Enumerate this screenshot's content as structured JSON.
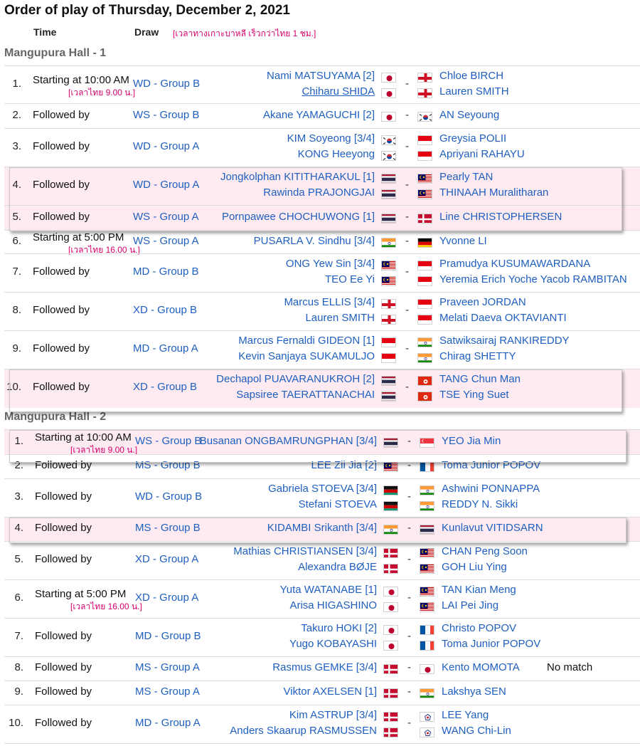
{
  "page": {
    "title": "Order of play of Thursday, December 2, 2021",
    "col_time": "Time",
    "col_draw": "Draw",
    "thai_note": "[เวลาทางเกาะบาหลี เร็วกว่าไทย 1 ชม.]"
  },
  "halls": [
    {
      "name": "Mangupura Hall - 1",
      "matches": [
        {
          "num": "1.",
          "time": "Starting at 10:00 AM",
          "note": "[เวลาไทย 9.00 น.]",
          "draw": "WD - Group B",
          "left": [
            {
              "name": "Nami MATSUYAMA [2]",
              "flag": "jpn"
            },
            {
              "name": "Chiharu SHIDA",
              "flag": "jpn",
              "underline": true
            }
          ],
          "right": [
            {
              "name": "Chloe BIRCH",
              "flag": "eng"
            },
            {
              "name": "Lauren SMITH",
              "flag": "eng"
            }
          ]
        },
        {
          "num": "2.",
          "time": "Followed by",
          "draw": "WS - Group B",
          "left": [
            {
              "name": "Akane YAMAGUCHI [2]",
              "flag": "jpn"
            }
          ],
          "right": [
            {
              "name": "AN Seyoung",
              "flag": "kor"
            }
          ]
        },
        {
          "num": "3.",
          "time": "Followed by",
          "draw": "WD - Group A",
          "left": [
            {
              "name": "KIM Soyeong [3/4]",
              "flag": "kor"
            },
            {
              "name": "KONG Heeyong",
              "flag": "kor"
            }
          ],
          "right": [
            {
              "name": "Greysia POLII",
              "flag": "ina"
            },
            {
              "name": "Apriyani RAHAYU",
              "flag": "ina"
            }
          ]
        },
        {
          "num": "4.",
          "time": "Followed by",
          "draw": "WD - Group A",
          "highlight": true,
          "left": [
            {
              "name": "Jongkolphan KITITHARAKUL [1]",
              "flag": "tha"
            },
            {
              "name": "Rawinda PRAJONGJAI",
              "flag": "tha"
            }
          ],
          "right": [
            {
              "name": "Pearly TAN",
              "flag": "mas"
            },
            {
              "name": "THINAAH Muralitharan",
              "flag": "mas"
            }
          ]
        },
        {
          "num": "5.",
          "time": "Followed by",
          "draw": "WS - Group A",
          "highlight": true,
          "left": [
            {
              "name": "Pornpawee CHOCHUWONG [1]",
              "flag": "tha"
            }
          ],
          "right": [
            {
              "name": "Line CHRISTOPHERSEN",
              "flag": "den"
            }
          ]
        },
        {
          "num": "6.",
          "time": "Starting at 5:00 PM",
          "note": "[เวลาไทย 16.00 น.]",
          "draw": "WS - Group A",
          "left": [
            {
              "name": "PUSARLA V. Sindhu [3/4]",
              "flag": "ind"
            }
          ],
          "right": [
            {
              "name": "Yvonne LI",
              "flag": "ger"
            }
          ]
        },
        {
          "num": "7.",
          "time": "Followed by",
          "draw": "MD - Group B",
          "left": [
            {
              "name": "ONG Yew Sin [3/4]",
              "flag": "mas"
            },
            {
              "name": "TEO Ee Yi",
              "flag": "mas"
            }
          ],
          "right": [
            {
              "name": "Pramudya KUSUMAWARDANA",
              "flag": "ina"
            },
            {
              "name": "Yeremia Erich Yoche Yacob RAMBITAN",
              "flag": "ina"
            }
          ]
        },
        {
          "num": "8.",
          "time": "Followed by",
          "draw": "XD - Group B",
          "left": [
            {
              "name": "Marcus ELLIS [3/4]",
              "flag": "eng"
            },
            {
              "name": "Lauren SMITH",
              "flag": "eng"
            }
          ],
          "right": [
            {
              "name": "Praveen JORDAN",
              "flag": "ina"
            },
            {
              "name": "Melati Daeva OKTAVIANTI",
              "flag": "ina"
            }
          ]
        },
        {
          "num": "9.",
          "time": "Followed by",
          "draw": "MD - Group A",
          "left": [
            {
              "name": "Marcus Fernaldi GIDEON [1]",
              "flag": "ina"
            },
            {
              "name": "Kevin Sanjaya SUKAMULJO",
              "flag": "ina"
            }
          ],
          "right": [
            {
              "name": "Satwiksairaj RANKIREDDY",
              "flag": "ind"
            },
            {
              "name": "Chirag SHETTY",
              "flag": "ind"
            }
          ]
        },
        {
          "num": "10.",
          "time": "Followed by",
          "draw": "XD - Group B",
          "highlight": true,
          "left": [
            {
              "name": "Dechapol PUAVARANUKROH [2]",
              "flag": "tha"
            },
            {
              "name": "Sapsiree TAERATTANACHAI",
              "flag": "tha"
            }
          ],
          "right": [
            {
              "name": "TANG Chun Man",
              "flag": "hkg"
            },
            {
              "name": "TSE Ying Suet",
              "flag": "hkg"
            }
          ]
        }
      ]
    },
    {
      "name": "Mangupura Hall - 2",
      "matches": [
        {
          "num": "1.",
          "time": "Starting at 10:00 AM",
          "note": "[เวลาไทย 9.00 น.]",
          "draw": "WS - Group B",
          "highlight": true,
          "left": [
            {
              "name": "Busanan ONGBAMRUNGPHAN [3/4]",
              "flag": "tha"
            }
          ],
          "right": [
            {
              "name": "YEO Jia Min",
              "flag": "sgp"
            }
          ]
        },
        {
          "num": "2.",
          "time": "Followed by",
          "draw": "MS - Group B",
          "left": [
            {
              "name": "LEE Zii Jia [2]",
              "flag": "mas"
            }
          ],
          "right": [
            {
              "name": "Toma Junior POPOV",
              "flag": "fra"
            }
          ]
        },
        {
          "num": "3.",
          "time": "Followed by",
          "draw": "WD - Group B",
          "left": [
            {
              "name": "Gabriela STOEVA [3/4]",
              "flag": "bul"
            },
            {
              "name": "Stefani STOEVA",
              "flag": "bul"
            }
          ],
          "right": [
            {
              "name": "Ashwini PONNAPPA",
              "flag": "ind"
            },
            {
              "name": "REDDY N. Sikki",
              "flag": "ind"
            }
          ]
        },
        {
          "num": "4.",
          "time": "Followed by",
          "draw": "MS - Group B",
          "highlight": true,
          "left": [
            {
              "name": "KIDAMBI Srikanth [3/4]",
              "flag": "ind"
            }
          ],
          "right": [
            {
              "name": "Kunlavut VITIDSARN",
              "flag": "tha"
            }
          ]
        },
        {
          "num": "5.",
          "time": "Followed by",
          "draw": "XD - Group A",
          "left": [
            {
              "name": "Mathias CHRISTIANSEN [3/4]",
              "flag": "den"
            },
            {
              "name": "Alexandra BØJE",
              "flag": "den"
            }
          ],
          "right": [
            {
              "name": "CHAN Peng Soon",
              "flag": "mas"
            },
            {
              "name": "GOH Liu Ying",
              "flag": "mas"
            }
          ]
        },
        {
          "num": "6.",
          "time": "Starting at 5:00 PM",
          "note": "[เวลาไทย 16.00 น.]",
          "draw": "XD - Group A",
          "left": [
            {
              "name": "Yuta WATANABE [1]",
              "flag": "jpn"
            },
            {
              "name": "Arisa HIGASHINO",
              "flag": "jpn"
            }
          ],
          "right": [
            {
              "name": "TAN Kian Meng",
              "flag": "mas"
            },
            {
              "name": "LAI Pei Jing",
              "flag": "mas"
            }
          ]
        },
        {
          "num": "7.",
          "time": "Followed by",
          "draw": "MD - Group B",
          "left": [
            {
              "name": "Takuro HOKI [2]",
              "flag": "jpn"
            },
            {
              "name": "Yugo KOBAYASHI",
              "flag": "jpn"
            }
          ],
          "right": [
            {
              "name": "Christo POPOV",
              "flag": "fra"
            },
            {
              "name": "Toma Junior POPOV",
              "flag": "fra"
            }
          ]
        },
        {
          "num": "8.",
          "time": "Followed by",
          "draw": "MS - Group A",
          "extra": "No match",
          "left": [
            {
              "name": "Rasmus GEMKE [3/4]",
              "flag": "den"
            }
          ],
          "right": [
            {
              "name": "Kento MOMOTA",
              "flag": "jpn"
            }
          ]
        },
        {
          "num": "9.",
          "time": "Followed by",
          "draw": "MS - Group A",
          "left": [
            {
              "name": "Viktor AXELSEN [1]",
              "flag": "den"
            }
          ],
          "right": [
            {
              "name": "Lakshya SEN",
              "flag": "ind"
            }
          ]
        },
        {
          "num": "10.",
          "time": "Followed by",
          "draw": "MD - Group A",
          "left": [
            {
              "name": "Kim ASTRUP [3/4]",
              "flag": "den"
            },
            {
              "name": "Anders Skaarup RASMUSSEN",
              "flag": "den"
            }
          ],
          "right": [
            {
              "name": "LEE Yang",
              "flag": "tpe"
            },
            {
              "name": "WANG Chi-Lin",
              "flag": "tpe"
            }
          ]
        }
      ]
    }
  ]
}
